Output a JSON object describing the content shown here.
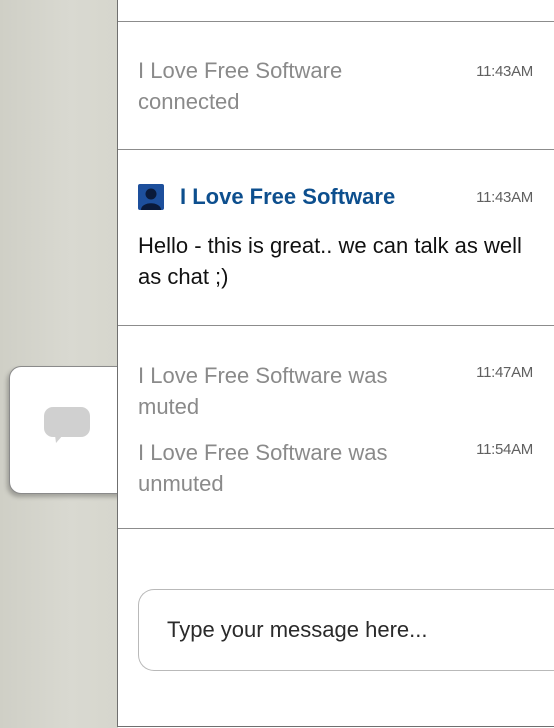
{
  "messages": {
    "connected": {
      "text": "I Love Free Software connected",
      "time": "11:43AM"
    },
    "chat": {
      "sender": "I Love Free Software",
      "time": "11:43AM",
      "text": "Hello - this is great.. we can talk as well as chat ;)"
    },
    "muted": {
      "text": "I Love Free Software was muted",
      "time": "11:47AM"
    },
    "unmuted": {
      "text": "I Love Free Software was unmuted",
      "time": "11:54AM"
    }
  },
  "composer": {
    "placeholder": "Type your message here..."
  },
  "icons": {
    "chat_tab": "chat-bubble-icon",
    "avatar": "user-avatar-icon"
  },
  "colors": {
    "sender": "#0d4f8e",
    "avatar": "#1d4f9c",
    "system_text": "#8a8a8a"
  }
}
